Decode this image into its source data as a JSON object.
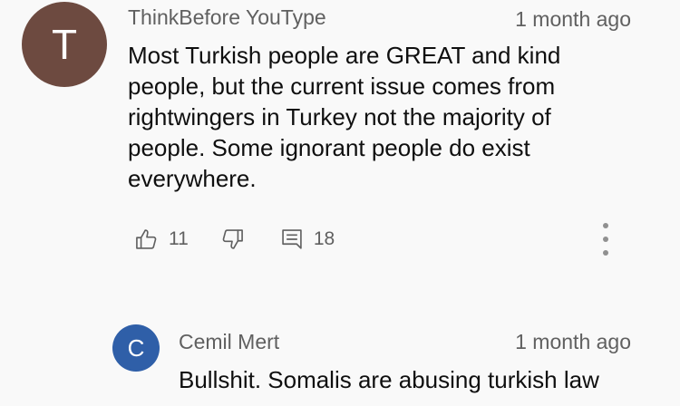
{
  "comments": [
    {
      "avatar_letter": "T",
      "avatar_color": "#6d4a40",
      "author": "ThinkBefore YouType",
      "time": "1 month ago",
      "text": "Most Turkish people are GREAT and kind people, but the current issue comes from rightwingers in Turkey not the majority of people. Some ignorant people do exist everywhere.",
      "likes": "11",
      "replies": "18"
    },
    {
      "avatar_letter": "C",
      "avatar_color": "#2f5fa8",
      "author": "Cemil Mert",
      "time": "1 month ago",
      "text": "Bullshit. Somalis are abusing turkish law"
    }
  ],
  "icons": {
    "like": "thumbs-up-icon",
    "dislike": "thumbs-down-icon",
    "reply": "comment-icon",
    "more": "more-vertical-icon"
  }
}
